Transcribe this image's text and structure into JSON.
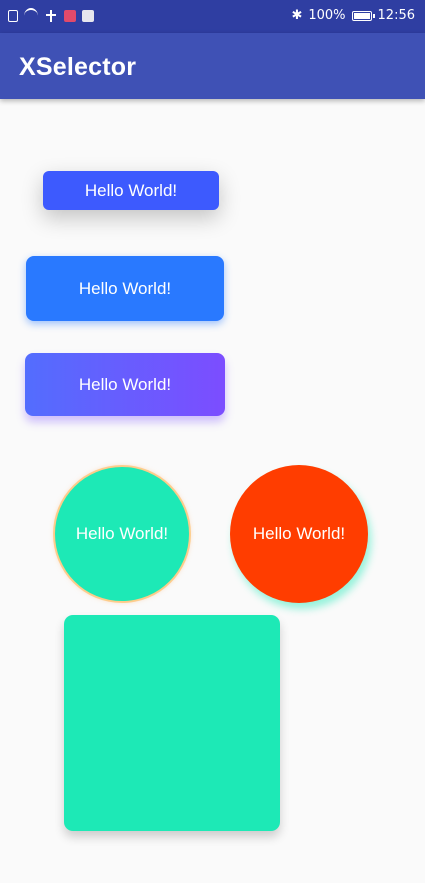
{
  "status_bar": {
    "battery_text": "100%",
    "time": "12:56",
    "left_icons": [
      "file-icon",
      "wifi-icon",
      "usb-icon",
      "app-notification-icon",
      "app-notification-icon-2"
    ],
    "right_icons": [
      "bluetooth-icon",
      "battery-icon"
    ]
  },
  "app_bar": {
    "title": "XSelector",
    "color": "#3F51B5"
  },
  "buttons": [
    {
      "label": "Hello World!",
      "color": "#3D5AFE"
    },
    {
      "label": "Hello World!",
      "color": "#2979FF"
    },
    {
      "label": "Hello World!",
      "gradient": [
        "#536DFE",
        "#7C4DFF"
      ]
    },
    {
      "label": "Hello World!",
      "color": "#1DE9B6",
      "shape": "circle"
    },
    {
      "label": "Hello World!",
      "color": "#FF3D00",
      "shape": "circle"
    }
  ],
  "square": {
    "color": "#1DE9B6"
  }
}
